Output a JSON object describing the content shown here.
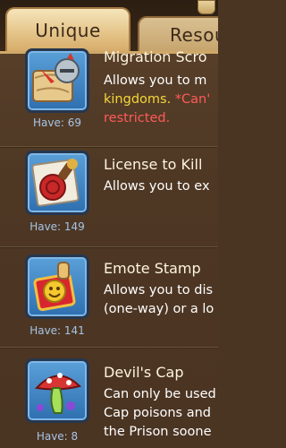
{
  "tabs": {
    "unique_label": "Unique",
    "resources_label": "Resou"
  },
  "items": [
    {
      "name": "Migration Scro",
      "desc_line1": "Allows you to m",
      "desc_line2_highlight": "kingdoms.",
      "desc_line2_warning": " *Can'",
      "desc_line3_warning": "restricted.",
      "have": "Have: 69",
      "icon": "migration-scroll-icon"
    },
    {
      "name": "License to Kill",
      "desc_line1": "Allows you to ex",
      "have": "Have: 149",
      "icon": "license-to-kill-seal-icon"
    },
    {
      "name": "Emote Stamp",
      "desc_line1": "Allows you to dis",
      "desc_line2": "(one-way) or a lo",
      "have": "Have: 141",
      "icon": "emote-stamp-icon"
    },
    {
      "name": "Devil's Cap",
      "desc_line1": "Can only be used",
      "desc_line2": "Cap poisons and",
      "desc_line3": "the Prison soone",
      "have": "Have: 8",
      "icon": "devils-cap-mushroom-icon"
    }
  ],
  "colors": {
    "highlight_yellow": "#f5d63a",
    "warning_red": "#ff5a5a",
    "have_text": "#a7c4e6"
  }
}
